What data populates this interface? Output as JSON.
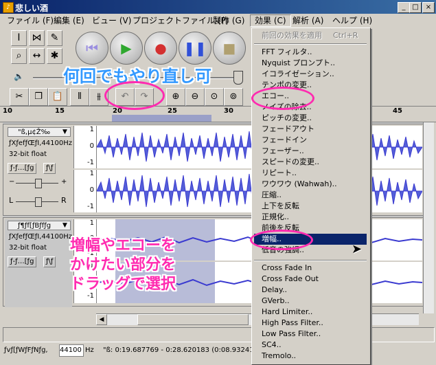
{
  "window": {
    "title": "悲しい酒",
    "minimize": "_",
    "maximize": "□",
    "close": "×"
  },
  "menubar": [
    {
      "label": "ファイル (F)"
    },
    {
      "label": "編集 (E)"
    },
    {
      "label": "ビュー (V)"
    },
    {
      "label": "プロジェクトファイル (P)"
    },
    {
      "label": "製作 (G)"
    },
    {
      "label": "効果 (C)"
    },
    {
      "label": "解析 (A)"
    },
    {
      "label": "ヘルプ (H)"
    }
  ],
  "ruler": {
    "ticks": [
      "10",
      "15",
      "20",
      "25",
      "30",
      "45"
    ]
  },
  "tracks": [
    {
      "name": "\"ß,µ¢Ž‰",
      "rate": "ƒXƒefƒŒƒI,44100Hz",
      "format": "32-bit float",
      "mute": "ƒ-ƒ…[ƒg",
      "solo": "ƒ\\ƒ",
      "axis": [
        "1",
        "0",
        "-1"
      ],
      "axis2": [
        "1",
        "0",
        "-1"
      ]
    },
    {
      "name": "ƒ¶ƒf[ƒBƒfƒg",
      "rate": "ƒXƒefƒŒƒI,44100Hz",
      "format": "32-bit float",
      "mute": "ƒ-ƒ…[ƒg",
      "solo": "ƒ\\ƒ",
      "axis": [
        "1",
        "0",
        "-1"
      ],
      "axis2": [
        "1",
        "0",
        "-1"
      ]
    }
  ],
  "status": {
    "rate_label": "ƒvƒ[ƒWƒFƒNƒg,",
    "rate_value": "44100",
    "rate_suffix": "Hz",
    "selection": "\"ß: 0:19.687769 - 0:28.620183 (0:08.932414"
  },
  "effects_menu": {
    "repeat_last": "前回の効果を適用",
    "repeat_shortcut": "Ctrl+R",
    "items_a": [
      "FFT フィルタ..",
      "Nyquist プロンプト..",
      "イコライゼーション..",
      "テンポの変更..",
      "エコー..",
      "ノイズの除去..",
      "ピッチの変更..",
      "フェードアウト",
      "フェードイン",
      "フェーザー..",
      "スピードの変更..",
      "リピート..",
      "ワウワウ (Wahwah)..",
      "圧縮..",
      "上下を反転",
      "正規化..",
      "前後を反転",
      "増幅..",
      "低音の強調.."
    ],
    "items_b": [
      "Cross Fade In",
      "Cross Fade Out",
      "Delay..",
      "GVerb..",
      "Hard Limiter..",
      "High Pass Filter..",
      "Low Pass Filter..",
      "SC4..",
      "Tremolo.."
    ]
  },
  "annotations": {
    "undo_note": "何回でもやり直し可",
    "drag_note_1": "増幅やエコーを",
    "drag_note_2": "かけたい部分を",
    "drag_note_3": "ドラッグで選択"
  }
}
